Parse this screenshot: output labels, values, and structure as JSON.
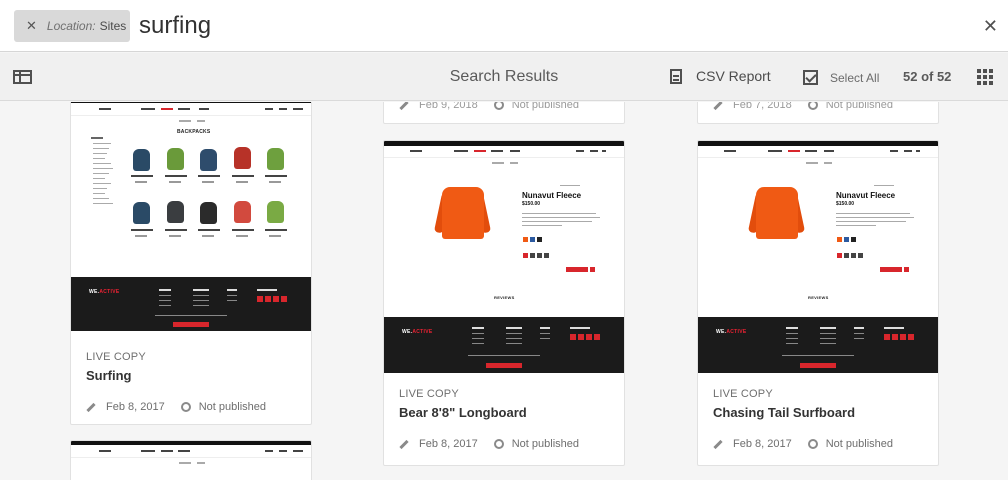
{
  "search": {
    "filter_tag": {
      "key": "Location:",
      "value": "Sites",
      "remove_icon": "close-icon"
    },
    "query": "surfing",
    "close_icon": "close-icon"
  },
  "toolbar": {
    "title": "Search Results",
    "csv_label": "CSV Report",
    "select_all_label": "Select All",
    "count": "52 of 52"
  },
  "cards": [
    {
      "type": "LIVE COPY",
      "title": "Surfing",
      "date": "Feb 8, 2017",
      "status": "Not published"
    },
    {
      "type": "LIVE COPY",
      "title": "Bear 8'8\" Longboard",
      "date": "Feb 8, 2017",
      "status": "Not published"
    },
    {
      "type": "LIVE COPY",
      "title": "Chasing Tail Surfboard",
      "date": "Feb 8, 2017",
      "status": "Not published"
    }
  ],
  "stubs": [
    {
      "date": "Feb 9, 2018",
      "status": "Not published"
    },
    {
      "date": "Feb 7, 2018",
      "status": "Not published"
    }
  ],
  "thumbnails": {
    "surfing": {
      "section_title": "BACKPACKS",
      "logo": "WE.",
      "logo_accent": "ACTIVE"
    },
    "product": {
      "product_name": "Nunavut Fleece",
      "price": "$150.00",
      "reviews_label": "REVIEWS",
      "logo": "WE.",
      "logo_accent": "ACTIVE"
    }
  },
  "colors": {
    "accent": "#d8262c",
    "fleece": "#f05a14"
  }
}
